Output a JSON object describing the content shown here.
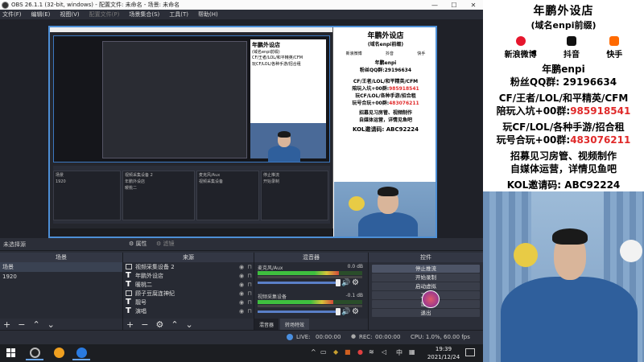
{
  "window": {
    "title": "OBS 26.1.1 (32-bit, windows) - 配置文件: 未命名 - 场景: 未命名",
    "controls": {
      "minimize": "—",
      "maximize": "☐",
      "close": "✕"
    }
  },
  "menu": [
    "文件(F)",
    "编辑(E)",
    "视图(V)",
    "配置文件(P)",
    "场景集合(S)",
    "工具(T)",
    "帮助(H)"
  ],
  "source_toolbar": {
    "no_selection": "未选择源",
    "properties": "属性",
    "filters": "滤镜"
  },
  "scenes": {
    "title": "场景",
    "items": [
      "场景",
      "1920"
    ]
  },
  "sources": {
    "title": "来源",
    "items": [
      {
        "type": "media",
        "label": "视频采集设备 2"
      },
      {
        "type": "text",
        "label": "年鹏外设店"
      },
      {
        "type": "text",
        "label": "暖桃二"
      },
      {
        "type": "media",
        "label": "顾子豆腐连神纪"
      },
      {
        "type": "text",
        "label": "靓号"
      },
      {
        "type": "text",
        "label": "演唱"
      }
    ]
  },
  "mixer": {
    "title": "混音器",
    "tracks": [
      {
        "name": "麦克风/Aux",
        "db": "0.0 dB",
        "level": 0.78
      },
      {
        "name": "视频采集设备",
        "db": "-0.1 dB",
        "level": 0.72
      }
    ],
    "tabs": [
      "混音器",
      "转场特效"
    ]
  },
  "controls": {
    "title": "控件",
    "buttons": [
      "停止推流",
      "开始录制",
      "启动虚拟",
      "工作",
      "设置",
      "退出"
    ]
  },
  "status": {
    "live_label": "LIVE:",
    "live_time": "00:00:00",
    "rec_label": "REC:",
    "rec_time": "00:00:00",
    "cpu": "CPU: 1.0%, 60.00 fps"
  },
  "taskbar": {
    "time": "19:39",
    "date": "2021/12/24",
    "ime": "中",
    "tray_icons": [
      "chevron-up-icon",
      "network-icon",
      "shield-icon",
      "volume-icon"
    ]
  },
  "promo": {
    "title": "年鹏外设店",
    "subtitle": "(域名enpi前缀)",
    "socials": [
      {
        "name": "新浪微博",
        "color": "#e6162d"
      },
      {
        "name": "抖音",
        "color": "#111111"
      },
      {
        "name": "快手",
        "color": "#ff6a00"
      }
    ],
    "handle": "年鹏enpi",
    "fan_group_label": "粉丝QQ群:",
    "fan_group": "29196634",
    "line1": "CF/王者/LOL/和平精英/CFM",
    "line2_label": "陪玩入坑+00群:",
    "line2_value": "985918541",
    "line3": "玩CF/LOL/各种手游/招合租",
    "line4_label": "玩号合玩+00群:",
    "line4_value": "483076211",
    "line5": "招募见习房管、视频制作",
    "line6": "自媒体运营，详情见鱼吧",
    "kol_label": "KOL邀请码:",
    "kol_code": "ABC92224"
  },
  "colors": {
    "accent": "#4d8fd6",
    "promo_red": "#e02a2a",
    "panel_bg": "#2b2e38"
  }
}
